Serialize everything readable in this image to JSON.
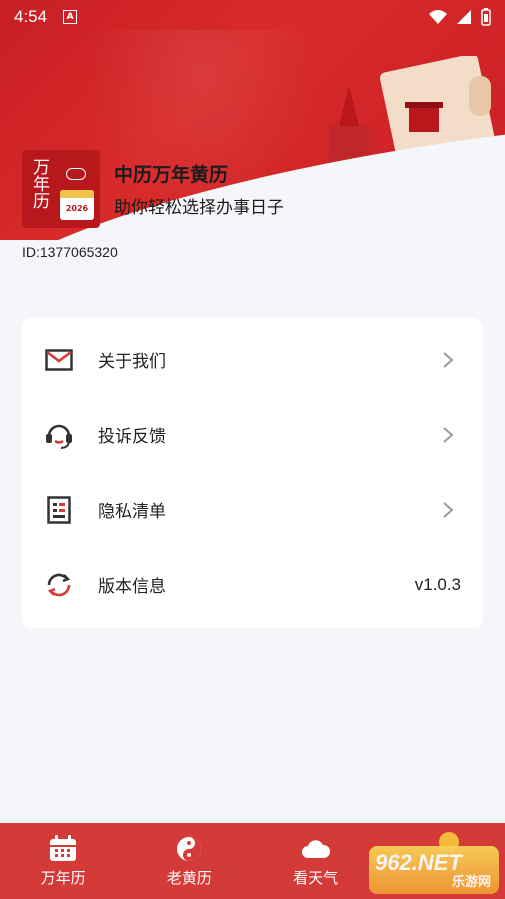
{
  "status_bar": {
    "time": "4:54",
    "notification_letter": "A"
  },
  "profile": {
    "icon_text": "万年历",
    "icon_year": "2026",
    "app_name": "中历万年黄历",
    "slogan": "助你轻松选择办事日子",
    "user_id": "ID:1377065320"
  },
  "menu": [
    {
      "label": "关于我们",
      "icon": "mail-icon",
      "action": "chevron"
    },
    {
      "label": "投诉反馈",
      "icon": "headset-icon",
      "action": "chevron"
    },
    {
      "label": "隐私清单",
      "icon": "list-icon",
      "action": "chevron"
    },
    {
      "label": "版本信息",
      "icon": "refresh-icon",
      "value": "v1.0.3"
    }
  ],
  "tabs": [
    {
      "label": "万年历",
      "icon": "calendar-icon"
    },
    {
      "label": "老黄历",
      "icon": "yin-yang-icon"
    },
    {
      "label": "看天气",
      "icon": "cloud-icon"
    }
  ],
  "watermark": {
    "main": "962.NET",
    "sub": "乐游网"
  },
  "colors": {
    "brand_red": "#c81e24",
    "tabbar_red": "#d43a38",
    "background": "#f5f6fa"
  }
}
